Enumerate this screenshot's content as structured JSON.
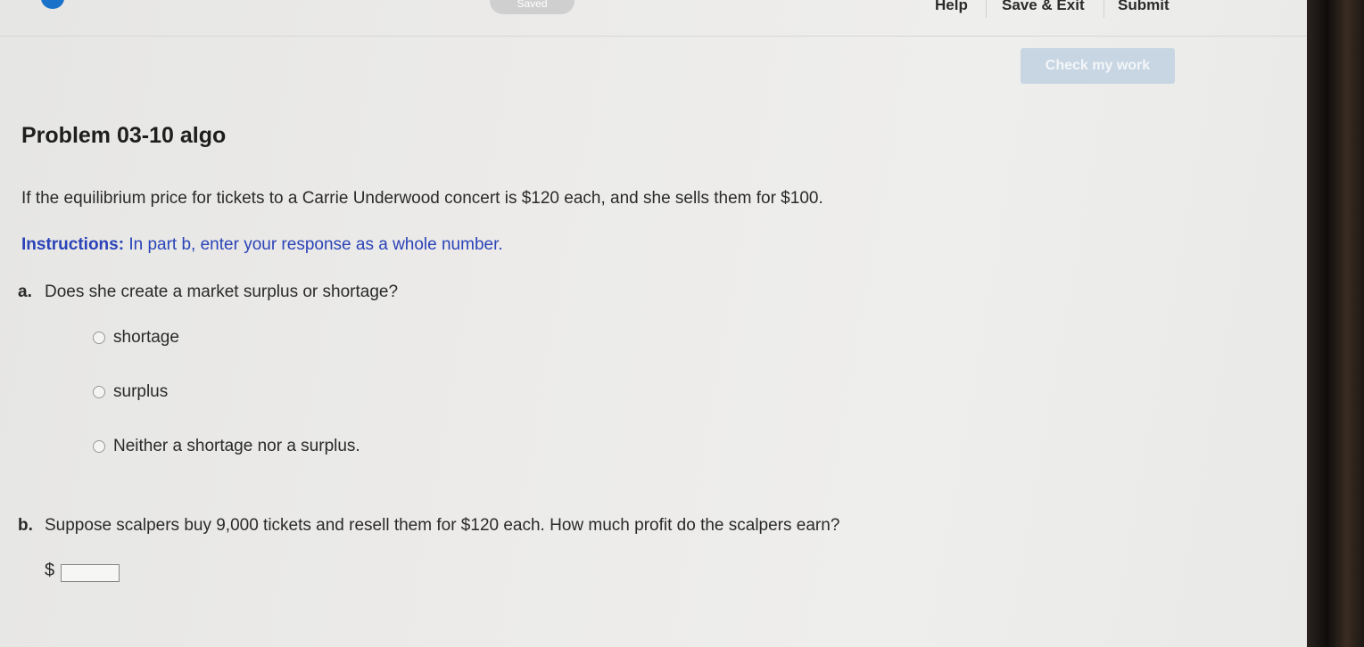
{
  "header": {
    "saved_label": "Saved",
    "help_label": "Help",
    "save_exit_label": "Save & Exit",
    "submit_label": "Submit"
  },
  "check_button": {
    "label": "Check my work"
  },
  "problem": {
    "title": "Problem 03-10 algo",
    "stem": "If the equilibrium price for tickets to a Carrie Underwood concert is $120 each, and she sells them for $100.",
    "instructions_label": "Instructions:",
    "instructions_text": " In part b, enter your response as a whole number."
  },
  "part_a": {
    "label": "a.",
    "question": "Does she create a market surplus or shortage?",
    "options": [
      "shortage",
      "surplus",
      "Neither a shortage nor a surplus."
    ]
  },
  "part_b": {
    "label": "b.",
    "question": "Suppose scalpers buy 9,000 tickets and resell them for $120 each. How much profit do the scalpers earn?",
    "currency": "$",
    "answer_value": ""
  },
  "colors": {
    "instructions": "#2a43b8",
    "check_button_bg": "#c8d6e3",
    "accent_blue": "#1a73c9"
  }
}
